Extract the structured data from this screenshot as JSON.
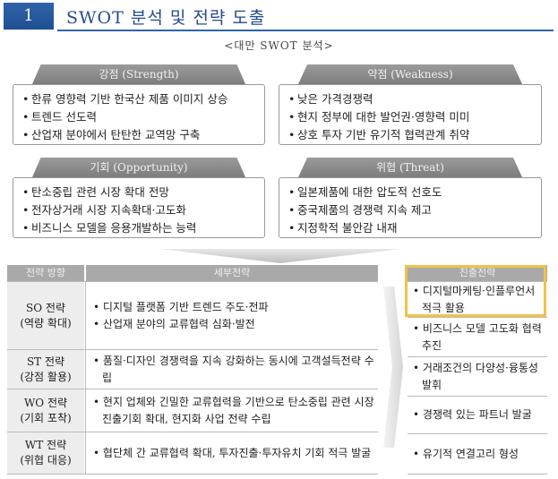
{
  "header": {
    "number": "1",
    "title": "SWOT 분석 및 전략 도출"
  },
  "subtitle": "<대만 SWOT 분석>",
  "swot": {
    "strength": {
      "title": "강점 (Strength)",
      "items": [
        "한류 영향력 기반 한국산 제품 이미지 상승",
        "트렌드 선도력",
        "산업재 분야에서 탄탄한 교역망 구축"
      ]
    },
    "weakness": {
      "title": "약점 (Weakness)",
      "items": [
        "낮은 가격경쟁력",
        "현지 정부에 대한 발언권·영향력 미미",
        "상호 투자 기반 유기적 협력관계 취약"
      ]
    },
    "opportunity": {
      "title": "기회 (Opportunity)",
      "items": [
        "탄소중립 관련 시장 확대 전망",
        "전자상거래 시장 지속확대·고도화",
        "비즈니스 모델을 응용개발하는 능력"
      ]
    },
    "threat": {
      "title": "위협 (Threat)",
      "items": [
        "일본제품에 대한 압도적 선호도",
        "중국제품의 경쟁력 지속 제고",
        "지정학적 불안감 내재"
      ]
    }
  },
  "strategy": {
    "headers": {
      "direction": "전략 방향",
      "detail": "세부전략",
      "entry": "진출전략"
    },
    "rows": [
      {
        "key_line1": "SO 전략",
        "key_line2": "(역량 확대)",
        "items": [
          "디지털 플랫폼 기반 트렌드 주도·전파",
          "산업재 분야의 교류협력 심화·발전"
        ]
      },
      {
        "key_line1": "ST 전략",
        "key_line2": "(강점 활용)",
        "items": [
          "품질·디자인 경쟁력을 지속 강화하는 동시에 고객설득전략 수립"
        ]
      },
      {
        "key_line1": "WO 전략",
        "key_line2": "(기회 포착)",
        "items": [
          "현지 업체와 긴밀한 교류협력을 기반으로 탄소중립 관련 시장 진출기회 확대, 현지화 사업 전략 수립"
        ]
      },
      {
        "key_line1": "WT 전략",
        "key_line2": "(위협 대응)",
        "items": [
          "협단체 간 교류협력 확대, 투자진출·투자유치 기회 적극 발굴"
        ]
      }
    ],
    "entry_items": [
      "디지털마케팅·인플루언서 적극 활용",
      "비즈니스 모델 고도화 협력 추진",
      "거래조건의 다양성·융통성 발휘",
      "경쟁력 있는 파트너 발굴",
      "유기적 연결고리 형성"
    ]
  }
}
